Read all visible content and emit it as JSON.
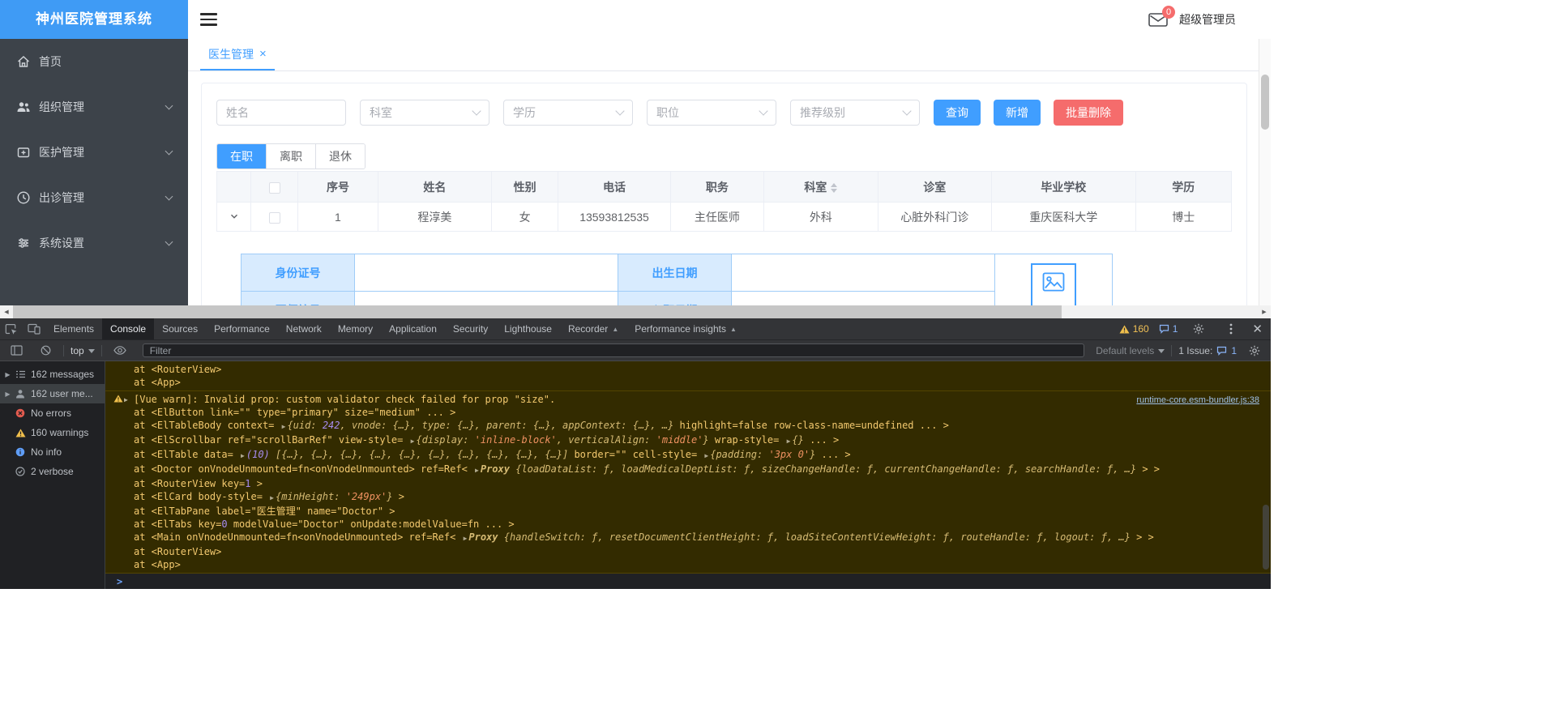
{
  "colors": {
    "primary": "#409eff",
    "danger": "#f56c6c",
    "sidebar_bg": "#3d434a",
    "logo_bg": "#3f9bf5",
    "warning_bg": "#332b00",
    "warning_text": "#f3c96f"
  },
  "app": {
    "logo": "神州医院管理系统",
    "header": {
      "user": "超级管理员",
      "badge_count": "0"
    },
    "sidebar": {
      "items": [
        {
          "id": "home",
          "label": "首页",
          "icon": "home-icon",
          "has_children": false
        },
        {
          "id": "org",
          "label": "组织管理",
          "icon": "org-icon",
          "has_children": true
        },
        {
          "id": "medical",
          "label": "医护管理",
          "icon": "medical-icon",
          "has_children": true
        },
        {
          "id": "visit",
          "label": "出诊管理",
          "icon": "visit-icon",
          "has_children": true
        },
        {
          "id": "settings",
          "label": "系统设置",
          "icon": "settings-icon",
          "has_children": true
        }
      ]
    },
    "tabs": [
      {
        "label": "医生管理",
        "active": true,
        "closable": true
      }
    ],
    "filters": {
      "name_placeholder": "姓名",
      "selects": [
        {
          "id": "dept",
          "placeholder": "科室"
        },
        {
          "id": "education",
          "placeholder": "学历"
        },
        {
          "id": "position",
          "placeholder": "职位"
        },
        {
          "id": "level",
          "placeholder": "推荐级别"
        }
      ],
      "buttons": [
        {
          "id": "search",
          "label": "查询",
          "type": "primary"
        },
        {
          "id": "add",
          "label": "新增",
          "type": "primary"
        },
        {
          "id": "batch-delete",
          "label": "批量删除",
          "type": "danger"
        }
      ]
    },
    "status_tabs": [
      {
        "id": "on-duty",
        "label": "在职",
        "active": true
      },
      {
        "id": "resigned",
        "label": "离职",
        "active": false
      },
      {
        "id": "retired",
        "label": "退休",
        "active": false
      }
    ],
    "table": {
      "columns": [
        {
          "label": "序号"
        },
        {
          "label": "姓名"
        },
        {
          "label": "性别"
        },
        {
          "label": "电话"
        },
        {
          "label": "职务"
        },
        {
          "label": "科室",
          "sortable": true
        },
        {
          "label": "诊室"
        },
        {
          "label": "毕业学校"
        },
        {
          "label": "学历"
        }
      ],
      "rows": [
        {
          "expanded": true,
          "cells": [
            "1",
            "程淳美",
            "女",
            "13593812535",
            "主任医师",
            "外科",
            "心脏外科门诊",
            "重庆医科大学",
            "博士"
          ]
        }
      ],
      "detail_labels": [
        "身份证号",
        "出生日期",
        "医师编号",
        "入职日期"
      ]
    }
  },
  "devtools": {
    "tabs": [
      {
        "label": "Elements",
        "active": false,
        "badge": false
      },
      {
        "label": "Console",
        "active": true,
        "badge": false
      },
      {
        "label": "Sources",
        "active": false,
        "badge": false
      },
      {
        "label": "Performance",
        "active": false,
        "badge": false
      },
      {
        "label": "Network",
        "active": false,
        "badge": false
      },
      {
        "label": "Memory",
        "active": false,
        "badge": false
      },
      {
        "label": "Application",
        "active": false,
        "badge": false
      },
      {
        "label": "Security",
        "active": false,
        "badge": false
      },
      {
        "label": "Lighthouse",
        "active": false,
        "badge": false
      },
      {
        "label": "Recorder",
        "active": false,
        "badge": true
      },
      {
        "label": "Performance insights",
        "active": false,
        "badge": true
      }
    ],
    "counts": {
      "warnings": "160",
      "messages": "1"
    },
    "toolbar": {
      "context": "top",
      "filter_placeholder": "Filter",
      "levels": "Default levels",
      "issues_label": "1 Issue:",
      "issues_count": "1"
    },
    "sidebar": [
      {
        "label": "162 messages",
        "icon": "list-icon",
        "expandable": true,
        "selected": false
      },
      {
        "label": "162 user me...",
        "icon": "user-icon",
        "expandable": true,
        "selected": true
      },
      {
        "label": "No errors",
        "icon": "error-icon",
        "expandable": false,
        "selected": false
      },
      {
        "label": "160 warnings",
        "icon": "warning-icon",
        "expandable": false,
        "selected": false
      },
      {
        "label": "No info",
        "icon": "info-icon",
        "expandable": false,
        "selected": false
      },
      {
        "label": "2 verbose",
        "icon": "verbose-icon",
        "expandable": false,
        "selected": false
      }
    ],
    "console": {
      "prompt": ">",
      "entries": [
        {
          "level": "warning",
          "icon": false,
          "link": null,
          "lines": [
            [
              [
                "w",
                "at <RouterView>"
              ]
            ],
            [
              [
                "w",
                "at <App>"
              ]
            ]
          ]
        },
        {
          "level": "warning",
          "icon": true,
          "link": "runtime-core.esm-bundler.js:38",
          "lines": [
            [
              [
                "w",
                "[Vue warn]: Invalid prop: custom validator check failed for prop \"size\"."
              ]
            ],
            [
              [
                "w",
                "at <ElButton link=\"\" type=\"primary\" size=\"medium\"  ... >"
              ]
            ],
            [
              [
                "w",
                "at <ElTableBody context= "
              ],
              [
                "c",
                "▶"
              ],
              [
                "i",
                "{uid: "
              ],
              [
                "in",
                "242"
              ],
              [
                "i",
                ", vnode: {…}, type: {…}, parent: {…}, appContext: {…}, …}"
              ],
              [
                "w",
                " highlight=false row-class-name=undefined  ... >"
              ]
            ],
            [
              [
                "w",
                "at <ElScrollbar ref=\"scrollBarRef\" view-style= "
              ],
              [
                "c",
                "▶"
              ],
              [
                "i",
                "{display: "
              ],
              [
                "is",
                "'inline-block'"
              ],
              [
                "i",
                ", verticalAlign: "
              ],
              [
                "is",
                "'middle'"
              ],
              [
                "i",
                "}"
              ],
              [
                "w",
                " wrap-style= "
              ],
              [
                "c",
                "▶"
              ],
              [
                "i",
                "{}"
              ],
              [
                "w",
                "  ... >"
              ]
            ],
            [
              [
                "w",
                "at <ElTable data= "
              ],
              [
                "c",
                "▶"
              ],
              [
                "in",
                "(10) "
              ],
              [
                "i",
                "[{…}, {…}, {…}, {…}, {…}, {…}, {…}, {…}, {…}, {…}]"
              ],
              [
                "w",
                " border=\"\" cell-style= "
              ],
              [
                "c",
                "▶"
              ],
              [
                "i",
                "{padding: "
              ],
              [
                "is",
                "'3px 0'"
              ],
              [
                "i",
                "}"
              ],
              [
                "w",
                "  ... >"
              ]
            ],
            [
              [
                "w",
                "at <Doctor onVnodeUnmounted=fn<onVnodeUnmounted> ref=Ref< "
              ],
              [
                "c",
                "▶"
              ],
              [
                "ib",
                "Proxy "
              ],
              [
                "i",
                "{loadDataList: "
              ],
              [
                "if",
                "ƒ"
              ],
              [
                "i",
                ", loadMedicalDeptList: "
              ],
              [
                "if",
                "ƒ"
              ],
              [
                "i",
                ", sizeChangeHandle: "
              ],
              [
                "if",
                "ƒ"
              ],
              [
                "i",
                ", currentChangeHandle: "
              ],
              [
                "if",
                "ƒ"
              ],
              [
                "i",
                ", searchHandle: "
              ],
              [
                "if",
                "ƒ"
              ],
              [
                "i",
                ", …}"
              ],
              [
                "w",
                " > >"
              ]
            ],
            [
              [
                "w",
                "at <RouterView key="
              ],
              [
                "n",
                "1"
              ],
              [
                "w",
                " >"
              ]
            ],
            [
              [
                "w",
                "at <ElCard body-style= "
              ],
              [
                "c",
                "▶"
              ],
              [
                "i",
                "{minHeight: "
              ],
              [
                "is",
                "'249px'"
              ],
              [
                "i",
                "}"
              ],
              [
                "w",
                " >"
              ]
            ],
            [
              [
                "w",
                "at <ElTabPane label=\"医生管理\" name=\"Doctor\" >"
              ]
            ],
            [
              [
                "w",
                "at <ElTabs key="
              ],
              [
                "n",
                "0"
              ],
              [
                "w",
                " modelValue=\"Doctor\" onUpdate:modelValue=fn  ... >"
              ]
            ],
            [
              [
                "w",
                "at <Main onVnodeUnmounted=fn<onVnodeUnmounted> ref=Ref< "
              ],
              [
                "c",
                "▶"
              ],
              [
                "ib",
                "Proxy "
              ],
              [
                "i",
                "{handleSwitch: "
              ],
              [
                "if",
                "ƒ"
              ],
              [
                "i",
                ", resetDocumentClientHeight: "
              ],
              [
                "if",
                "ƒ"
              ],
              [
                "i",
                ", loadSiteContentViewHeight: "
              ],
              [
                "if",
                "ƒ"
              ],
              [
                "i",
                ", routeHandle: "
              ],
              [
                "if",
                "ƒ"
              ],
              [
                "i",
                ", logout: "
              ],
              [
                "if",
                "ƒ"
              ],
              [
                "i",
                ", …}"
              ],
              [
                "w",
                " > >"
              ]
            ],
            [
              [
                "w",
                "at <RouterView>"
              ]
            ],
            [
              [
                "w",
                "at <App>"
              ]
            ]
          ]
        }
      ]
    }
  }
}
